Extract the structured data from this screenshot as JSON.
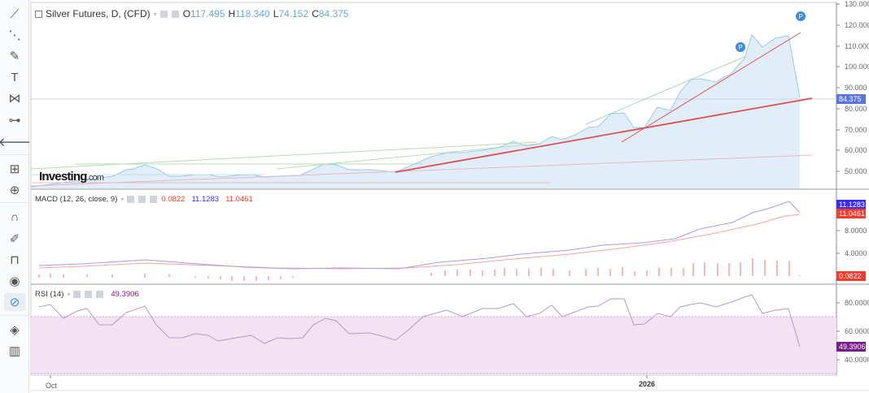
{
  "toolbar": {
    "items": [
      "trend-line",
      "fib-tools",
      "brush",
      "text",
      "patterns",
      "prediction",
      "back",
      "measure",
      "zoom-in",
      "magnet",
      "lock-drawing",
      "unlock",
      "visibility",
      "link",
      "layers",
      "trash"
    ]
  },
  "main": {
    "title": "Silver Futures, D, (CFD)",
    "o_label": "O",
    "o": "117.495",
    "h_label": "H",
    "h": "118.340",
    "l_label": "L",
    "l": "74.152",
    "c_label": "C",
    "c": "84.375",
    "price_label": "84.375",
    "watermark": "Investing",
    "watermark_suffix": ".com",
    "marker": "P",
    "ticks": [
      "130.000",
      "120.000",
      "110.000",
      "100.000",
      "90.000",
      "80.000",
      "70.000",
      "60.000",
      "50.000"
    ]
  },
  "macd": {
    "title": "MACD (12, 26, close, 9)",
    "hist": "0.0822",
    "macd": "11.1283",
    "signal": "11.0461",
    "ticks": [
      "8.0000",
      "4.0000"
    ]
  },
  "rsi": {
    "title": "RSI (14)",
    "value": "49.3906",
    "ticks": [
      "80.0000",
      "60.0000",
      "40.0000"
    ]
  },
  "time_axis": {
    "labels": [
      "Oct",
      "2026"
    ]
  },
  "colors": {
    "price": "#9cc8ea",
    "fill": "#e1eef9",
    "trend_red": "#d9534f",
    "macd": "#3b2cf5",
    "signal": "#f53b2c",
    "rsi": "#7b1a8c",
    "rsi_band": "#f3e3f2"
  }
}
